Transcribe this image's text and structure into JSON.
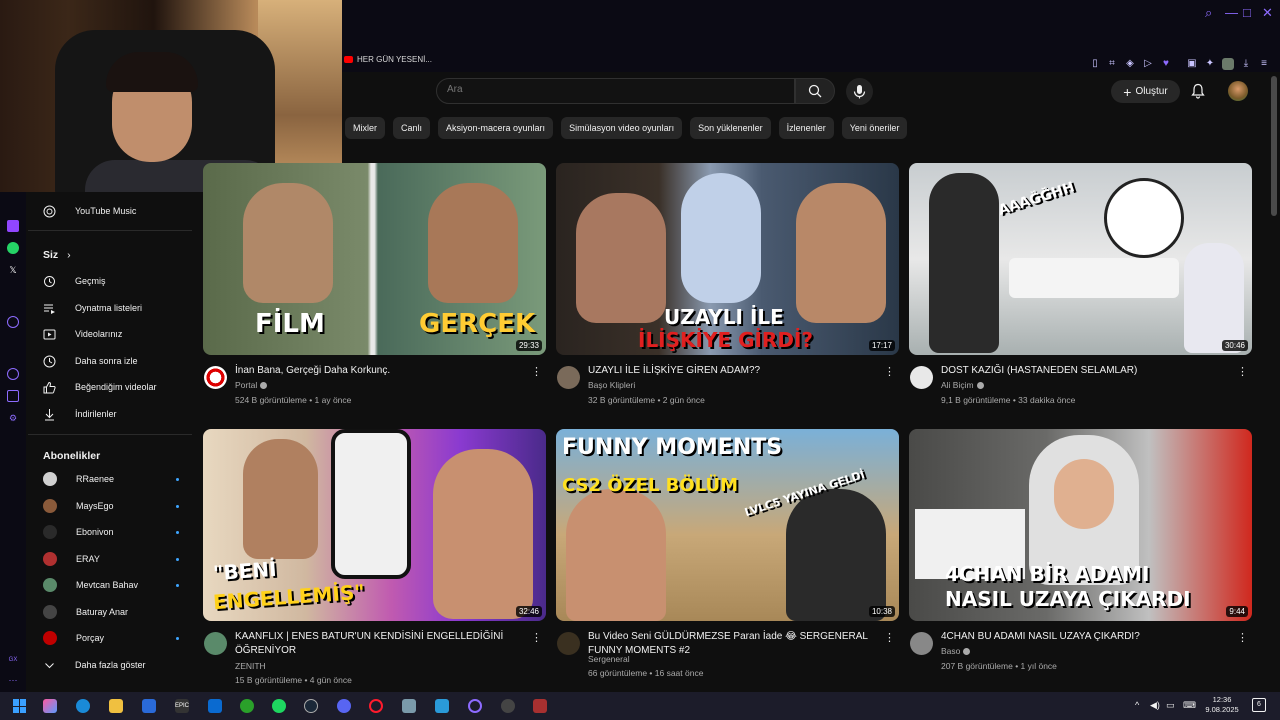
{
  "browser": {
    "tab_title": "HER GÜN YESENİ...",
    "colors": {
      "accent": "#8d6bff",
      "frame": "#0b0a14"
    }
  },
  "masthead": {
    "search_placeholder": "Ara",
    "create_label": "Oluştur"
  },
  "chips": [
    "Mixler",
    "Canlı",
    "Aksiyon-macera oyunları",
    "Simülasyon video oyunları",
    "Son yüklenenler",
    "İzlenenler",
    "Yeni öneriler"
  ],
  "sidebar": {
    "top_item": "YouTube Music",
    "you_title": "Siz",
    "you_items": [
      "Geçmiş",
      "Oynatma listeleri",
      "Videolarınız",
      "Daha sonra izle",
      "Beğendiğim videolar",
      "İndirilenler"
    ],
    "subs_title": "Abonelikler",
    "subs": [
      "RRaenee",
      "MaysEgo",
      "Ebonivon",
      "ERAY",
      "Mevtcan Bahav",
      "Baturay Anar",
      "Porçay"
    ],
    "show_more": "Daha fazla göster"
  },
  "videos": [
    {
      "title": "İnan Bana, Gerçeği Daha Korkunç.",
      "channel": "Portal",
      "stats": "524 B görüntüleme • 1 ay önce",
      "duration": "29:33",
      "thumb_left": "FİLM",
      "thumb_right": "GERÇEK"
    },
    {
      "title": "UZAYLI İLE İLİŞKİYE GİREN ADAM??",
      "channel": "Başo Klipleri",
      "stats": "32 B görüntüleme • 2 gün önce",
      "duration": "17:17",
      "thumb_line1": "UZAYLI İLE",
      "thumb_line2": "İLİŞKİYE GİRDİ?"
    },
    {
      "title": "DOST KAZIĞI (HASTANEDEN SELAMLAR)",
      "channel": "Ali Biçim",
      "stats": "9,1 B görüntüleme • 33 dakika önce",
      "duration": "30:46",
      "thumb_text": "AAAĞĞHH"
    },
    {
      "title": "KAANFLIX | ENES BATUR'UN KENDİSİNİ ENGELLEDİĞİNİ ÖĞRENİYOR",
      "channel": "ZENITH",
      "stats": "15 B görüntüleme • 4 gün önce",
      "duration": "32:46",
      "thumb_line1": "\"BENİ",
      "thumb_line2": "ENGELLEMİŞ\""
    },
    {
      "title": "Bu Video Seni GÜLDÜRMEZSE Paran İade 😂 SERGENERAL FUNNY MOMENTS #2",
      "channel": "Sergeneral",
      "stats": "66 görüntüleme • 16 saat önce",
      "duration": "10:38",
      "thumb_line1": "FUNNY MOMENTS",
      "thumb_line2": "CS2 ÖZEL BÖLÜM",
      "thumb_line3": "LVLC5 YAYINA GELDİ"
    },
    {
      "title": "4CHAN BU ADAMI NASIL UZAYA ÇIKARDI?",
      "channel": "Baso",
      "stats": "207 B görüntüleme • 1 yıl önce",
      "duration": "9:44",
      "thumb_line1": "4CHAN BİR ADAMI",
      "thumb_line2": "NASIL UZAYA ÇIKARDI"
    }
  ],
  "taskbar": {
    "time": "12:36",
    "date": "9.08.2025",
    "notifications": "6"
  }
}
